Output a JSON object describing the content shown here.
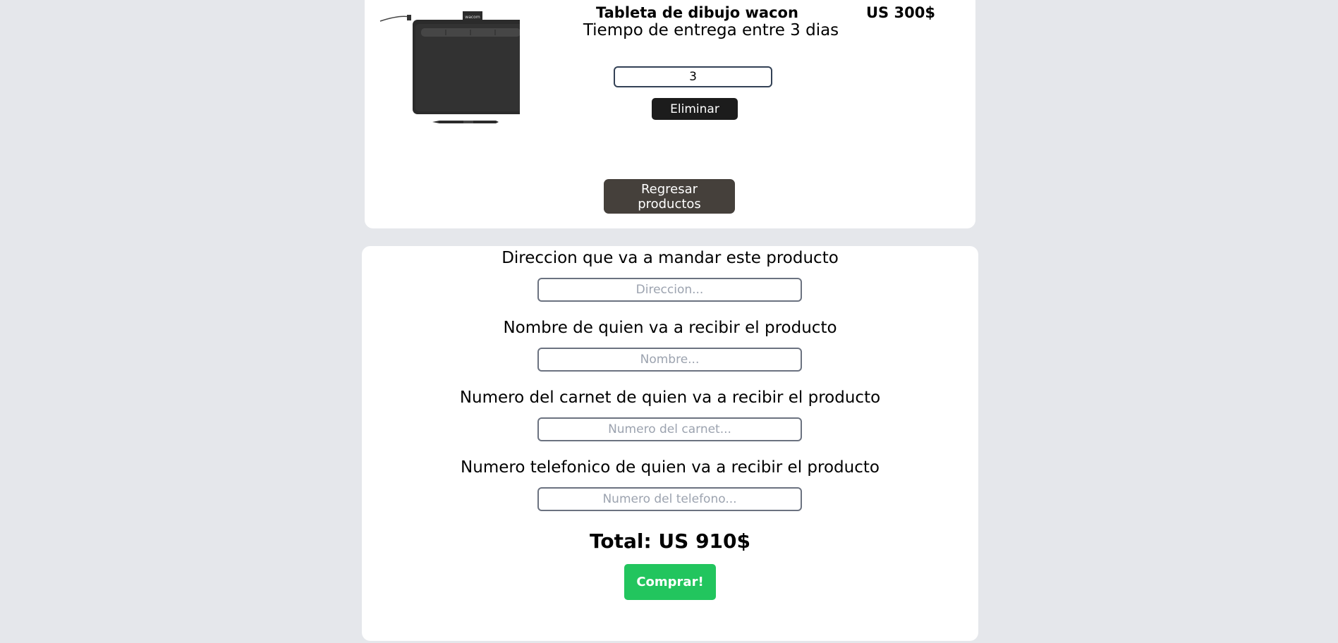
{
  "cart": {
    "product": {
      "name": "Tableta de dibujo wacon",
      "price": "US 300$",
      "image_brand": "wacom",
      "delivery": "Tiempo de entrega entre 3 dias",
      "quantity": "3",
      "delete_label": "Eliminar"
    },
    "back_label": "Regresar productos"
  },
  "checkout": {
    "address": {
      "label": "Direccion que va a mandar este producto",
      "placeholder": "Direccion...",
      "value": ""
    },
    "name": {
      "label": "Nombre de quien va a recibir el producto",
      "placeholder": "Nombre...",
      "value": ""
    },
    "id_card": {
      "label": "Numero del carnet de quien va a recibir el producto",
      "placeholder": "Numero del carnet...",
      "value": ""
    },
    "phone": {
      "label": "Numero telefonico de quien va a recibir el producto",
      "placeholder": "Numero del telefono...",
      "value": ""
    },
    "total": "Total: US 910$",
    "buy_label": "Comprar!"
  },
  "colors": {
    "page_bg": "#e5e7eb",
    "buy_button": "#22c55e",
    "delete_button": "#1c1c1c",
    "back_button": "#45403b"
  }
}
